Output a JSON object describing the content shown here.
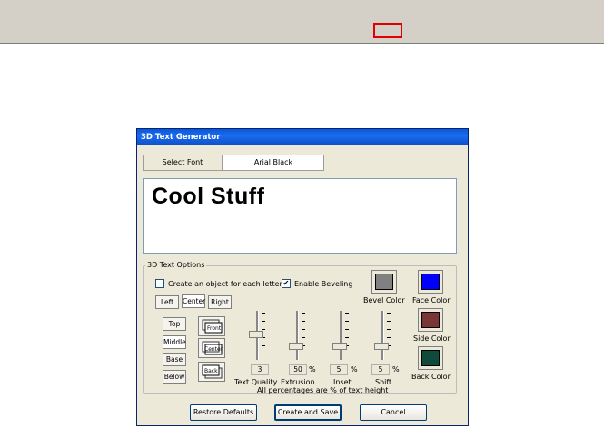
{
  "dialog": {
    "title": "3D Text Generator"
  },
  "tabs": [
    {
      "label": "Select Font",
      "selected": false
    },
    {
      "label": "Arial Black",
      "selected": true
    }
  ],
  "preview": {
    "text": "Cool Stuff"
  },
  "options": {
    "group_title": "3D Text Options",
    "create_object_per_letter": {
      "label": "Create an object for each letter",
      "checked": false
    },
    "enable_beveling": {
      "label": "Enable Beveling",
      "checked": true
    },
    "align_buttons": [
      "Left",
      "Center",
      "Right"
    ],
    "vertical_align_buttons": [
      "Top",
      "Middle",
      "Base",
      "Below"
    ],
    "view_buttons": [
      "Front",
      "Center",
      "Back"
    ]
  },
  "colors": {
    "bevel": {
      "label": "Bevel Color",
      "value": "#808080"
    },
    "face": {
      "label": "Face Color",
      "value": "#0000ff"
    },
    "side": {
      "label": "Side Color",
      "value": "#7a3535"
    },
    "back": {
      "label": "Back Color",
      "value": "#104a3a"
    }
  },
  "sliders": [
    {
      "label": "Text Quality",
      "value": "3",
      "unit": ""
    },
    {
      "label": "Extrusion",
      "value": "50",
      "unit": "%"
    },
    {
      "label": "Inset",
      "value": "5",
      "unit": "%"
    },
    {
      "label": "Shift",
      "value": "5",
      "unit": "%"
    }
  ],
  "note": "All percentages are % of text height",
  "buttons": {
    "restore": "Restore Defaults",
    "create": "Create and Save",
    "cancel": "Cancel"
  }
}
